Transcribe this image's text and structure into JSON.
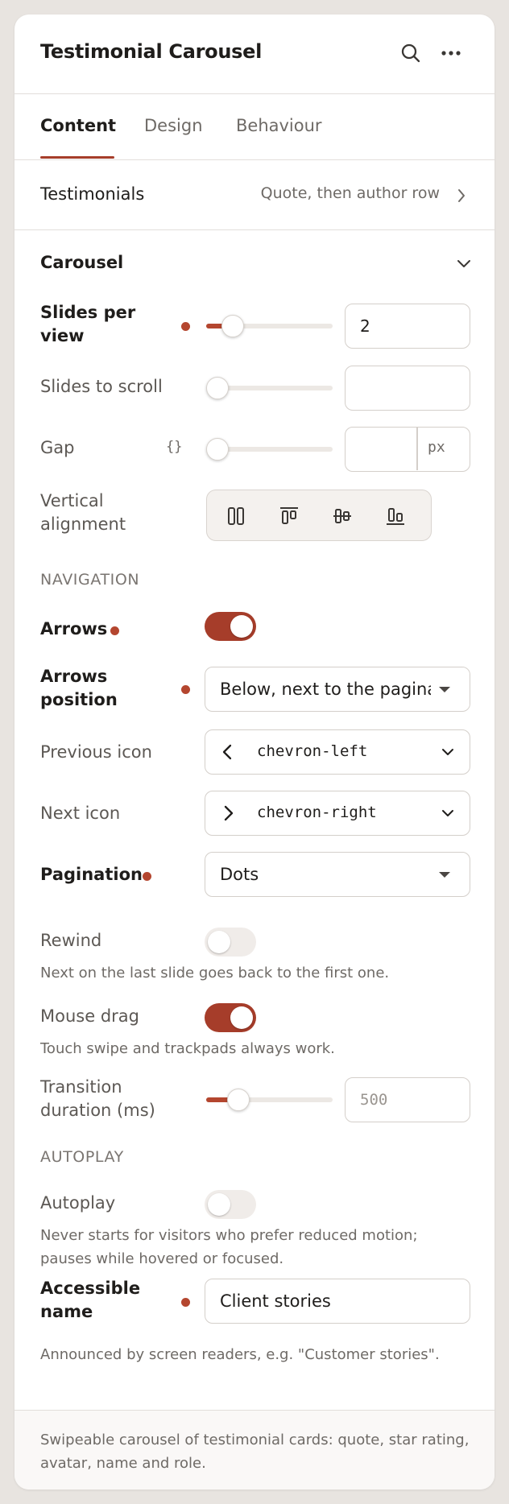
{
  "header": {
    "title": "Testimonial Carousel"
  },
  "tabs": [
    {
      "label": "Content",
      "active": true
    },
    {
      "label": "Design",
      "active": false
    },
    {
      "label": "Behaviour",
      "active": false
    }
  ],
  "testimonials_row": {
    "label": "Testimonials",
    "value": "Quote, then author row"
  },
  "carousel": {
    "heading": "Carousel",
    "slides_per_view": {
      "label": "Slides per view",
      "value": "2",
      "slider_fraction": 0.15,
      "modified": true
    },
    "slides_to_scroll": {
      "label": "Slides to scroll",
      "value": "",
      "slider_fraction": 0
    },
    "gap": {
      "label": "Gap",
      "dynamic_icon": "{}",
      "value": "",
      "unit": "px",
      "slider_fraction": 0
    },
    "vertical_alignment": {
      "label": "Vertical alignment",
      "options": [
        "stretch-icon",
        "align-top-icon",
        "align-middle-icon",
        "align-bottom-icon"
      ]
    }
  },
  "navigation": {
    "caption": "NAVIGATION",
    "arrows": {
      "label": "Arrows",
      "on": true,
      "modified": true
    },
    "arrows_position": {
      "label": "Arrows position",
      "value": "Below, next to the pagination",
      "modified": true
    },
    "previous_icon": {
      "label": "Previous icon",
      "glyph": "‹",
      "value": "chevron-left"
    },
    "next_icon": {
      "label": "Next icon",
      "glyph": "›",
      "value": "chevron-right"
    },
    "pagination": {
      "label": "Pagination",
      "value": "Dots",
      "modified": true
    },
    "rewind": {
      "label": "Rewind",
      "on": false,
      "help": "Next on the last slide goes back to the first one."
    },
    "mouse_drag": {
      "label": "Mouse drag",
      "on": true,
      "help": "Touch swipe and trackpads always work."
    },
    "transition": {
      "label": "Transition duration (ms)",
      "placeholder": "500",
      "slider_fraction": 0.2
    }
  },
  "autoplay": {
    "caption": "AUTOPLAY",
    "toggle": {
      "label": "Autoplay",
      "on": false,
      "help": "Never starts for visitors who prefer reduced motion; pauses while hovered or focused."
    },
    "accessible_name": {
      "label": "Accessible name",
      "value": "Client stories",
      "modified": true,
      "help": "Announced by screen readers, e.g. \"Customer stories\"."
    }
  },
  "footer": {
    "description": "Swipeable carousel of testimonial cards: quote, star rating, avatar, name and role."
  },
  "colors": {
    "accent": "#a63d2a",
    "modified_dot": "#b4462f",
    "page_bg": "#e8e4e0"
  }
}
